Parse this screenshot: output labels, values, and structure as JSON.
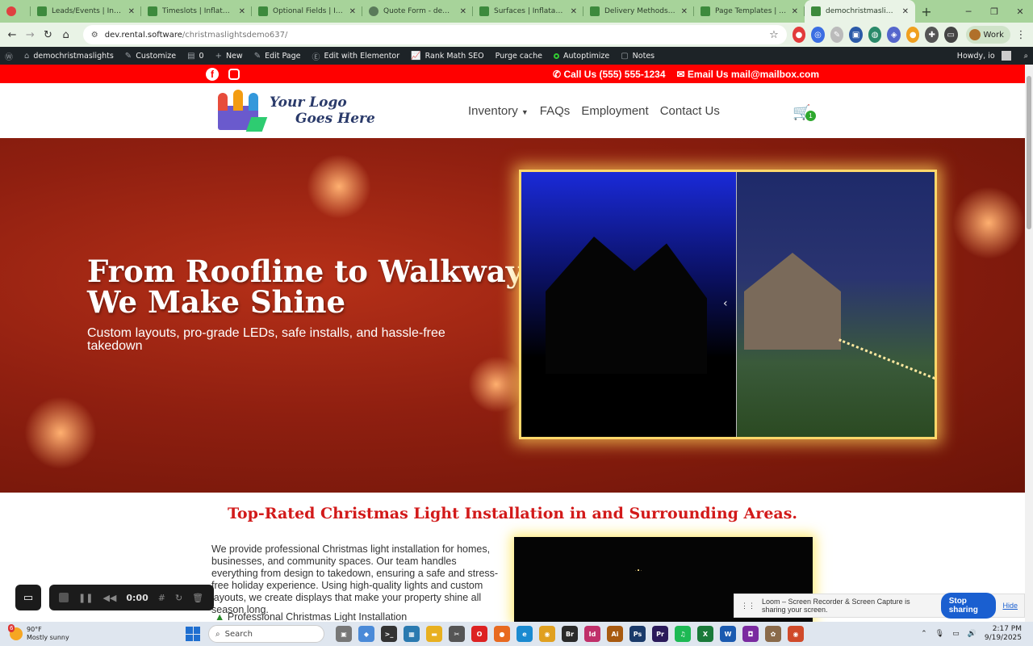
{
  "browser": {
    "tabs": [
      {
        "title": "",
        "icon": "record-icon",
        "active": false
      },
      {
        "title": "Leads/Events | InflatableO",
        "icon": "inflatableoffice-icon",
        "active": false
      },
      {
        "title": "Timeslots | InflatableOffice",
        "icon": "inflatableoffice-icon",
        "active": false
      },
      {
        "title": "Optional Fields | Inflatab",
        "icon": "inflatableoffice-icon",
        "active": false
      },
      {
        "title": "Quote Form - demochris",
        "icon": "globe-icon",
        "active": false
      },
      {
        "title": "Surfaces | InflatableOffice",
        "icon": "inflatableoffice-icon",
        "active": false
      },
      {
        "title": "Delivery Methods | Inflata",
        "icon": "inflatableoffice-icon",
        "active": false
      },
      {
        "title": "Page Templates | Inflatab",
        "icon": "inflatableoffice-icon",
        "active": false
      },
      {
        "title": "demochristmaslights",
        "icon": "inflatableoffice-icon",
        "active": true
      }
    ],
    "url_host": "dev.rental.software",
    "url_path": "/christmaslightsdemo637/",
    "profile_label": "Work"
  },
  "wp_admin": {
    "site_name": "demochristmaslights",
    "customize": "Customize",
    "comments": "0",
    "new": "New",
    "edit_page": "Edit Page",
    "elementor": "Edit with Elementor",
    "rankmath": "Rank Math SEO",
    "purge": "Purge cache",
    "autoptimize": "Autoptimize",
    "notes": "Notes",
    "howdy": "Howdy, io"
  },
  "topbar": {
    "phone": "Call Us (555) 555-1234",
    "email": "Email Us mail@mailbox.com"
  },
  "header": {
    "logo_line1": "Your Logo",
    "logo_line2": "Goes Here",
    "nav": [
      "Inventory",
      "FAQs",
      "Employment",
      "Contact Us"
    ],
    "cart_count": "1"
  },
  "hero": {
    "title_line1": "From Roofline to Walkway",
    "title_line2": "We Make Shine",
    "subtitle": "Custom layouts, pro-grade LEDs, safe installs, and hassle-free takedown"
  },
  "section": {
    "title": "Top-Rated Christmas Light Installation in and Surrounding Areas.",
    "intro": "We provide professional Christmas light installation for homes, businesses, and community spaces. Our team handles everything from design to takedown, ensuring a safe and stress-free holiday experience. Using high-quality lights and custom layouts, we create displays that make your property shine all season long.",
    "bullet1": "Professional Christmas Light Installation"
  },
  "loom": {
    "time": "0:00",
    "sharing_text": "Loom – Screen Recorder & Screen Capture is sharing your screen.",
    "stop": "Stop sharing",
    "hide": "Hide"
  },
  "taskbar": {
    "temp": "90°F",
    "weather": "Mostly sunny",
    "search": "Search",
    "time": "2:17 PM",
    "date": "9/19/2025",
    "weather_badge": "6"
  }
}
